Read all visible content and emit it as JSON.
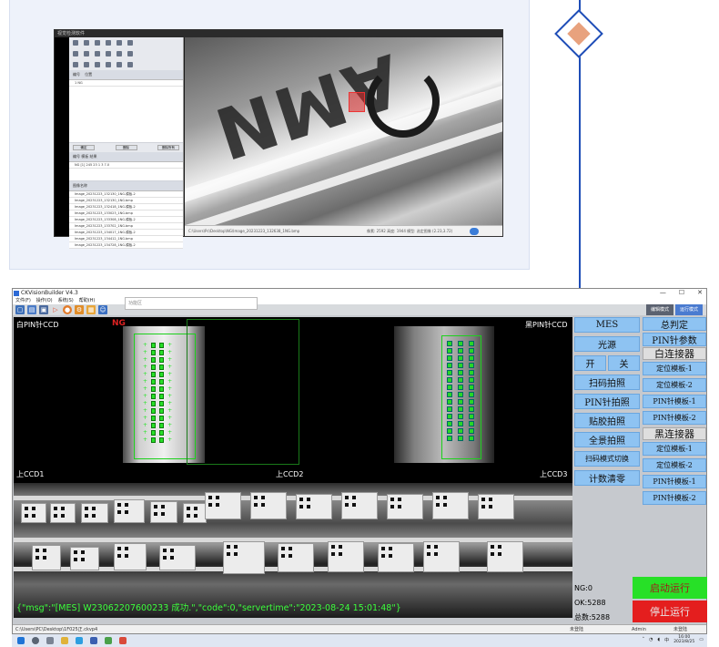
{
  "top_preview": {
    "window_title": "视觉检测软件",
    "sidebar_header_a": "编号",
    "sidebar_header_b": "位置",
    "sidebar_first_row": "1 NG",
    "btn_left": "确定",
    "btn_mid": "删除",
    "btn_right": "删除所有",
    "table_headers": "编号  模板  结果",
    "table_row": "NG  [1] 245 23 1 3 7.0",
    "list_header": "图像名称",
    "files": [
      "Image_20231223_132130_1NG-模板-2",
      "Image_20231223_132130_1NG.bmp",
      "Image_20231223_132418_1NG-模板-2",
      "Image_20231223_133023_1NG.bmp",
      "Image_20231223_133308_1NG-模板-2",
      "Image_20231223_133702_1NG.bmp",
      "Image_20231223_134017_1NG-模板-2",
      "Image_20231223_134412_1NG.bmp",
      "Image_20231223_134728_1NG-模板-2"
    ],
    "status_left": "C:\\Users\\Pc\\Desktop\\NG\\Image_20231223_132638_1NG.bmp",
    "status_right": "像素: 2592 高度: 1944 模型: 选定图像 (2.23,3.72)"
  },
  "app": {
    "title": "CKVisionBuilder V4.3",
    "window_controls": [
      "—",
      "☐",
      "✕"
    ],
    "menu": [
      "文件(F)",
      "操作(O)",
      "系统(S)",
      "帮助(H)"
    ],
    "search_placeholder": "功能区",
    "mode_edit": "编辑模式",
    "mode_run": "运行模式",
    "labels": {
      "white_pin": "白PIN针CCD",
      "black_pin": "黑PIN针CCD",
      "ng": "NG",
      "ccd1": "上CCD1",
      "ccd2": "上CCD2",
      "ccd3": "上CCD3"
    },
    "message": "{\"msg\":\"[MES] W23062207600233 成功.\",\"code\":0,\"servertime\":\"2023-08-24 15:01:48\"}",
    "buttons_col1": {
      "mes": "MES",
      "light": "光源",
      "on": "开",
      "off": "关",
      "scan_photo": "扫码拍照",
      "pin_photo": "PIN针拍照",
      "glue_photo": "贴胶拍照",
      "panorama": "全景拍照",
      "scan_switch": "扫码模式切换",
      "count_clear": "计数清零"
    },
    "buttons_col2": {
      "total": "总判定",
      "pin_param": "PIN针参数",
      "white_conn": "白连接器",
      "white_items": [
        "定位模板-1",
        "定位模板-2",
        "PIN针模板-1",
        "PIN针模板-2"
      ],
      "black_conn": "黑连接器",
      "black_items": [
        "定位模板-1",
        "定位模板-2",
        "PIN针模板-1",
        "PIN针模板-2"
      ]
    },
    "stats": {
      "ng": "NG:0",
      "ok": "OK:5288",
      "total": "总数:5288"
    },
    "start": "启动运行",
    "stop": "停止运行",
    "statusbar": {
      "path": "C:\\Users\\PC\\Desktop\\1F025正.ckvp4",
      "state": "未登陆",
      "user": "Admin",
      "mode": "未登陆"
    }
  },
  "taskbar": {
    "ime": "中",
    "time": "16:00",
    "date": "2023/8/25"
  },
  "colors": {
    "accent_blue": "#1e4db7",
    "pin_green": "#28e028",
    "start_green": "#27e027",
    "stop_red": "#e41e1e",
    "button_blue": "#8ec3f2"
  }
}
